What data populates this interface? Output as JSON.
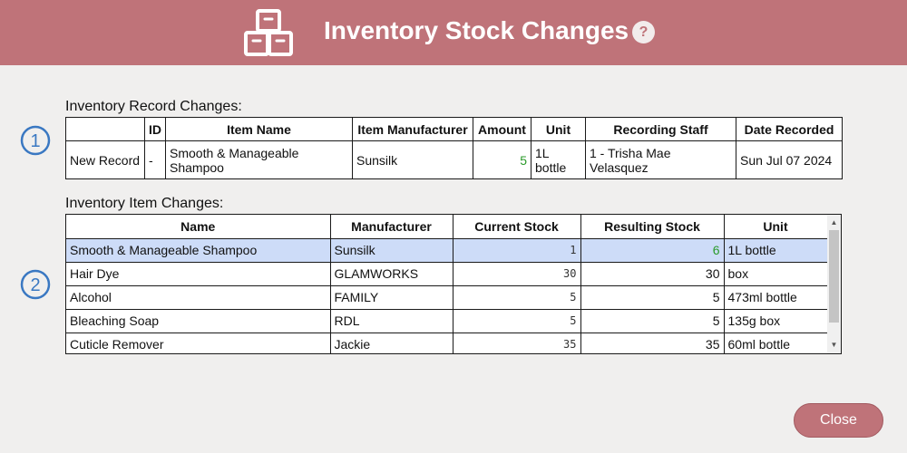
{
  "header": {
    "title": "Inventory Stock Changes",
    "help_label": "?",
    "icon": "boxes-icon",
    "color": "#bf7379"
  },
  "record_section": {
    "label": "Inventory Record Changes:",
    "step": "1",
    "columns": [
      "",
      "ID",
      "Item Name",
      "Item Manufacturer",
      "Amount",
      "Unit",
      "Recording Staff",
      "Date Recorded"
    ],
    "row": {
      "type": "New Record",
      "id": "-",
      "item_name": "Smooth & Manageable Shampoo",
      "manufacturer": "Sunsilk",
      "amount": "5",
      "unit": "1L bottle",
      "staff": "1 - Trisha Mae Velasquez",
      "date": "Sun Jul 07 2024"
    }
  },
  "items_section": {
    "label": "Inventory Item Changes:",
    "step": "2",
    "columns": [
      "Name",
      "Manufacturer",
      "Current Stock",
      "Resulting Stock",
      "Unit"
    ],
    "rows": [
      {
        "name": "Smooth & Manageable Shampoo",
        "manufacturer": "Sunsilk",
        "current": "1",
        "resulting": "6",
        "unit": "1L bottle"
      },
      {
        "name": "Hair Dye",
        "manufacturer": "GLAMWORKS",
        "current": "30",
        "resulting": "30",
        "unit": "box"
      },
      {
        "name": "Alcohol",
        "manufacturer": "FAMILY",
        "current": "5",
        "resulting": "5",
        "unit": "473ml bottle"
      },
      {
        "name": "Bleaching Soap",
        "manufacturer": "RDL",
        "current": "5",
        "resulting": "5",
        "unit": "135g box"
      },
      {
        "name": "Cuticle Remover",
        "manufacturer": "Jackie",
        "current": "35",
        "resulting": "35",
        "unit": "60ml bottle"
      }
    ]
  },
  "footer": {
    "close_label": "Close"
  }
}
